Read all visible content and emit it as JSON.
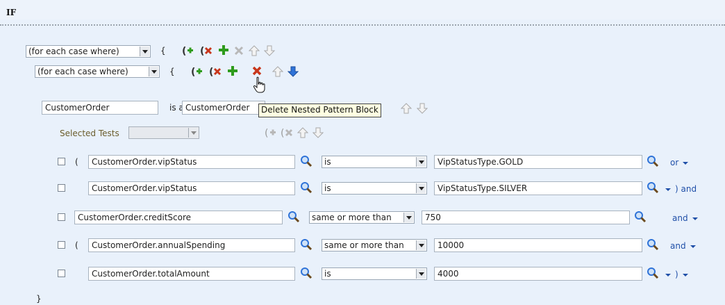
{
  "section": {
    "title": "IF"
  },
  "outer_block": {
    "quantifier": "(for each case where)",
    "open_brace": "{"
  },
  "inner_block": {
    "quantifier": "(for each case where)",
    "open_brace": "{"
  },
  "pattern": {
    "variable": "CustomerOrder",
    "is_a_label": "is a",
    "type": "CustomerOrder"
  },
  "tooltip": {
    "text": "Delete Nested Pattern Block"
  },
  "selected_tests": {
    "label": "Selected Tests",
    "value": ""
  },
  "tests": [
    {
      "open_paren": "(",
      "attribute": "CustomerOrder.vipStatus",
      "operator": "is",
      "value": "VipStatusType.GOLD",
      "connector": "or",
      "close_paren": "",
      "trail": ""
    },
    {
      "open_paren": "",
      "attribute": "CustomerOrder.vipStatus",
      "operator": "is",
      "value": "VipStatusType.SILVER",
      "connector": "",
      "close_paren": ") and",
      "trail": ""
    },
    {
      "open_paren": "",
      "attribute": "CustomerOrder.creditScore",
      "operator": "same or more than",
      "value": "750",
      "connector": "and",
      "close_paren": "",
      "trail": ""
    },
    {
      "open_paren": "(",
      "attribute": "CustomerOrder.annualSpending",
      "operator": "same or more than",
      "value": "10000",
      "connector": "and",
      "close_paren": "",
      "trail": ""
    },
    {
      "open_paren": "",
      "attribute": "CustomerOrder.totalAmount",
      "operator": "is",
      "value": "4000",
      "connector": "",
      "close_paren": ")",
      "trail": ""
    }
  ],
  "closing": {
    "brace": "}"
  },
  "colors": {
    "background": "#e9f1fb",
    "link": "#1f4fa8",
    "tooltip_bg": "#ffffe1",
    "add_green": "#2e9b1c",
    "delete_red": "#c8361b",
    "arrow_blue": "#2f73d8"
  }
}
